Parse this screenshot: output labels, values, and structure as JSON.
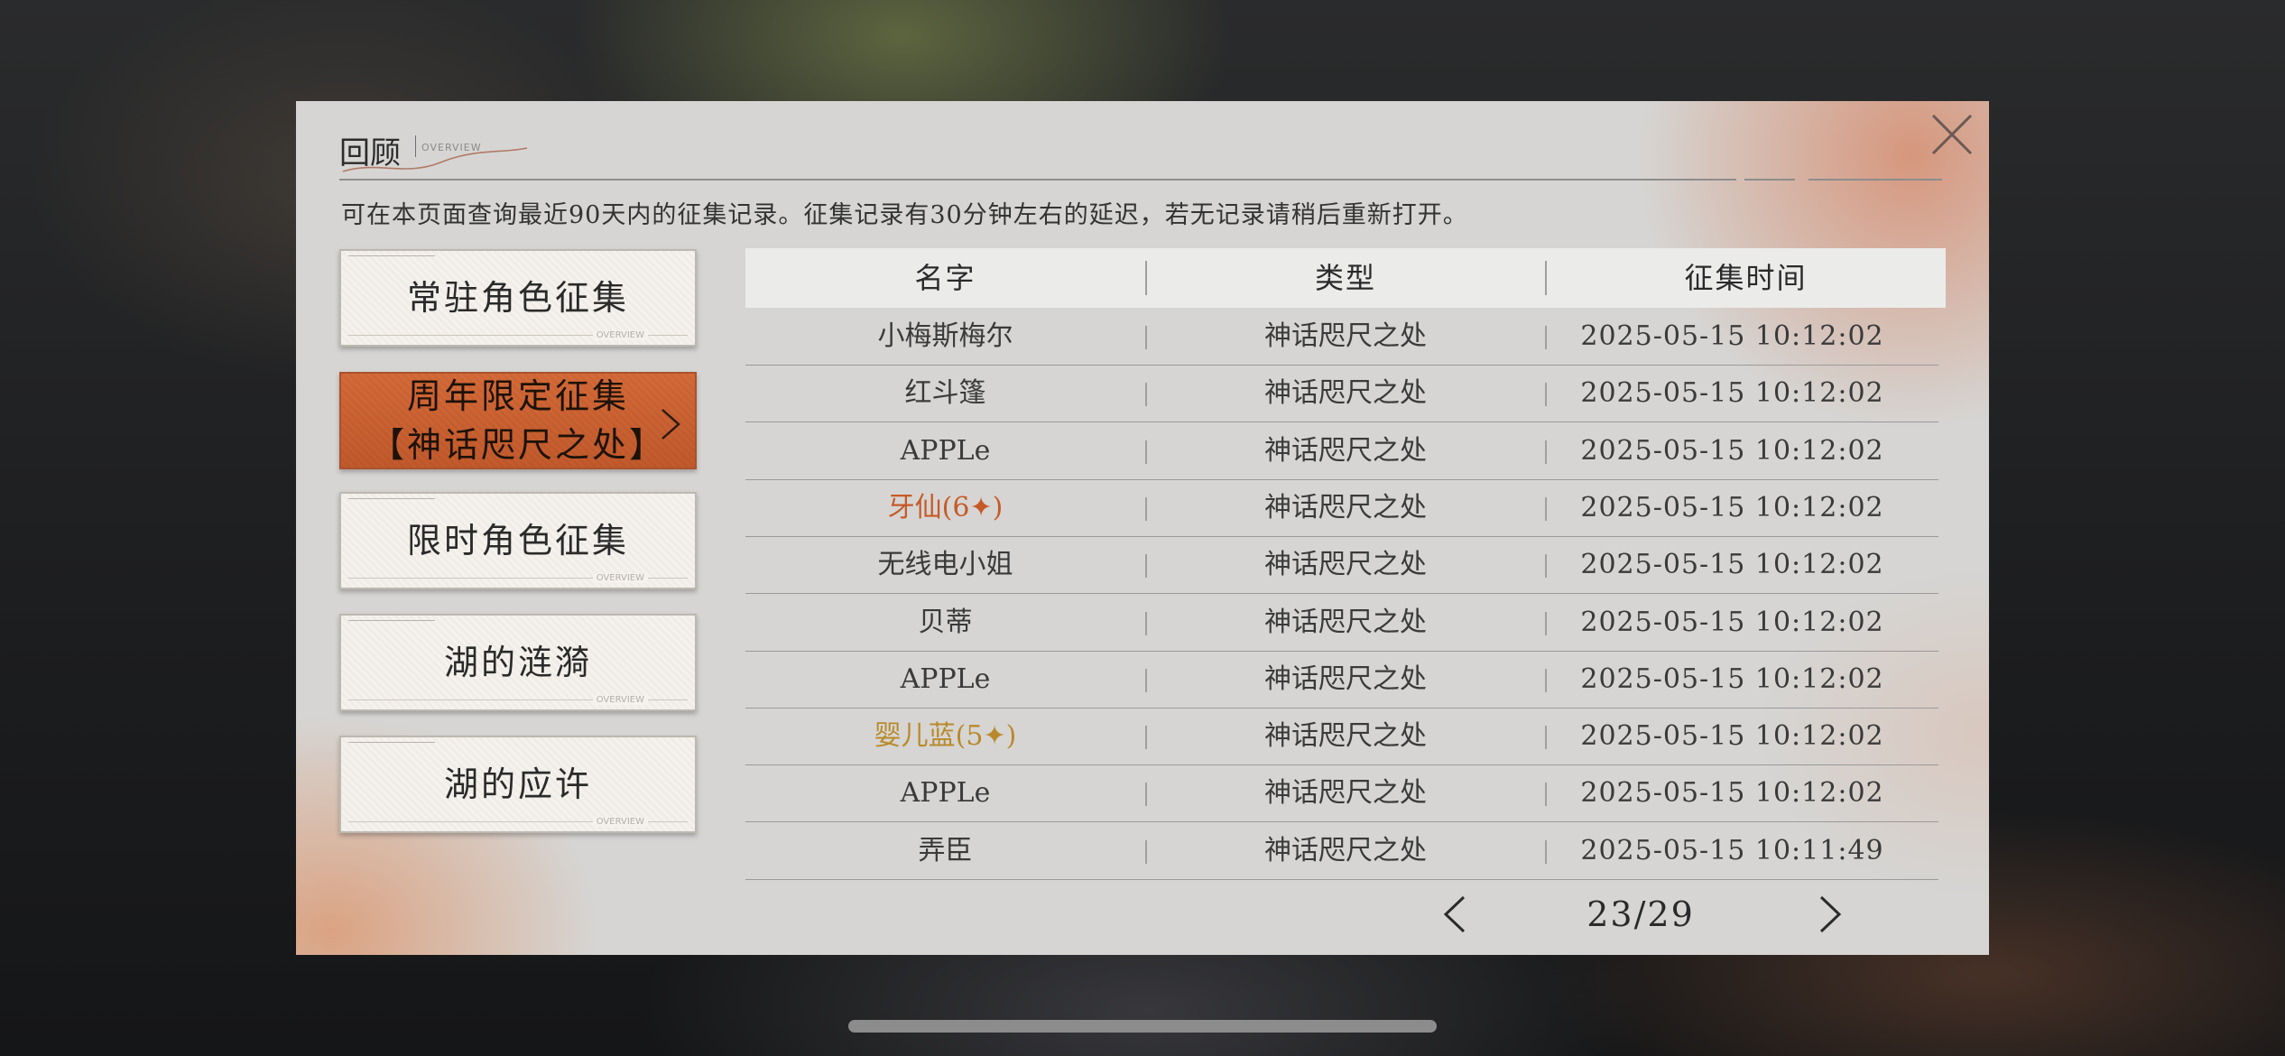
{
  "header": {
    "title": "回顾",
    "subtitle": "OVERVIEW",
    "notice": "可在本页面查询最近90天内的征集记录。征集记录有30分钟左右的延迟，若无记录请稍后重新打开。"
  },
  "menu": {
    "items": [
      {
        "label": "常驻角色征集",
        "tag": "OVERVIEW",
        "active": false
      },
      {
        "label": "周年限定征集\n【神话咫尺之处】",
        "tag": "",
        "active": true
      },
      {
        "label": "限时角色征集",
        "tag": "OVERVIEW",
        "active": false
      },
      {
        "label": "湖的涟漪",
        "tag": "OVERVIEW",
        "active": false
      },
      {
        "label": "湖的应许",
        "tag": "OVERVIEW",
        "active": false
      }
    ]
  },
  "table": {
    "headers": [
      "名字",
      "类型",
      "征集时间"
    ],
    "rows": [
      {
        "name": "小梅斯梅尔",
        "type": "神话咫尺之处",
        "time": "2025-05-15 10:12:02",
        "rarity": ""
      },
      {
        "name": "红斗篷",
        "type": "神话咫尺之处",
        "time": "2025-05-15 10:12:02",
        "rarity": ""
      },
      {
        "name": "APPLe",
        "type": "神话咫尺之处",
        "time": "2025-05-15 10:12:02",
        "rarity": ""
      },
      {
        "name": "牙仙(6✦)",
        "type": "神话咫尺之处",
        "time": "2025-05-15 10:12:02",
        "rarity": "orange"
      },
      {
        "name": "无线电小姐",
        "type": "神话咫尺之处",
        "time": "2025-05-15 10:12:02",
        "rarity": ""
      },
      {
        "name": "贝蒂",
        "type": "神话咫尺之处",
        "time": "2025-05-15 10:12:02",
        "rarity": ""
      },
      {
        "name": "APPLe",
        "type": "神话咫尺之处",
        "time": "2025-05-15 10:12:02",
        "rarity": ""
      },
      {
        "name": "婴儿蓝(5✦)",
        "type": "神话咫尺之处",
        "time": "2025-05-15 10:12:02",
        "rarity": "gold"
      },
      {
        "name": "APPLe",
        "type": "神话咫尺之处",
        "time": "2025-05-15 10:12:02",
        "rarity": ""
      },
      {
        "name": "弄臣",
        "type": "神话咫尺之处",
        "time": "2025-05-15 10:11:49",
        "rarity": ""
      }
    ]
  },
  "pager": {
    "text": "23/29",
    "prev_icon": "chevron-left-icon",
    "next_icon": "chevron-right-icon"
  },
  "icons": {
    "close": "close-icon",
    "menu_active_chevron": "chevron-right-icon"
  },
  "colors": {
    "accent_orange": "#c55a28",
    "rarity_gold": "#b88a2c",
    "active_tab": "#d06434"
  }
}
